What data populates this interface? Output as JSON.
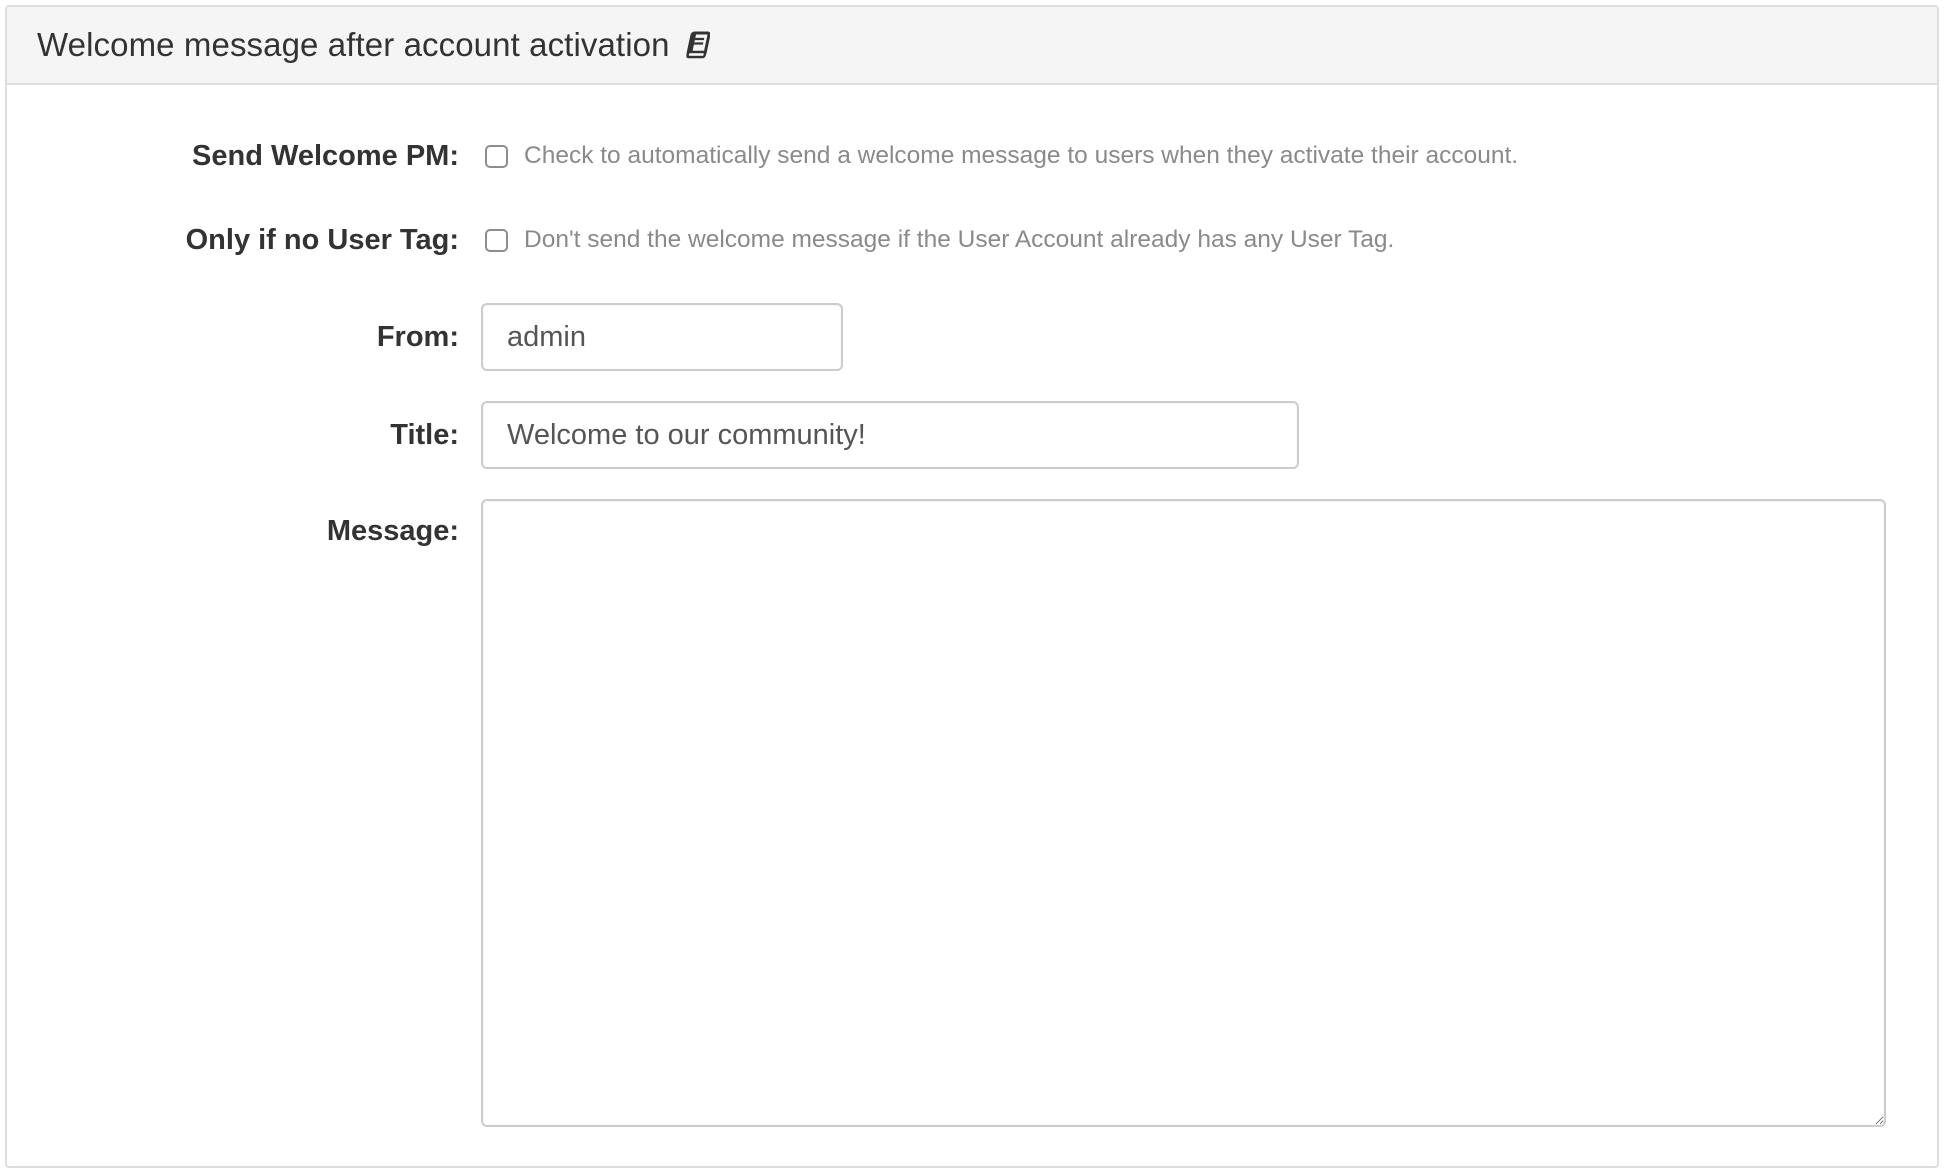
{
  "panel": {
    "title": "Welcome message after account activation",
    "title_icon": "book-icon"
  },
  "form": {
    "send_welcome_pm": {
      "label": "Send Welcome PM:",
      "checked": false,
      "help": "Check to automatically send a welcome message to users when they activate their account."
    },
    "only_if_no_user_tag": {
      "label": "Only if no User Tag:",
      "checked": false,
      "help": "Don't send the welcome message if the User Account already has any User Tag."
    },
    "from": {
      "label": "From:",
      "value": "admin"
    },
    "title": {
      "label": "Title:",
      "value": "Welcome to our community!"
    },
    "message": {
      "label": "Message:",
      "value": ""
    }
  },
  "colors": {
    "heading_bg": "#f5f5f5",
    "border": "#dddddd",
    "text": "#333333",
    "help_text": "#8a8a8a"
  }
}
